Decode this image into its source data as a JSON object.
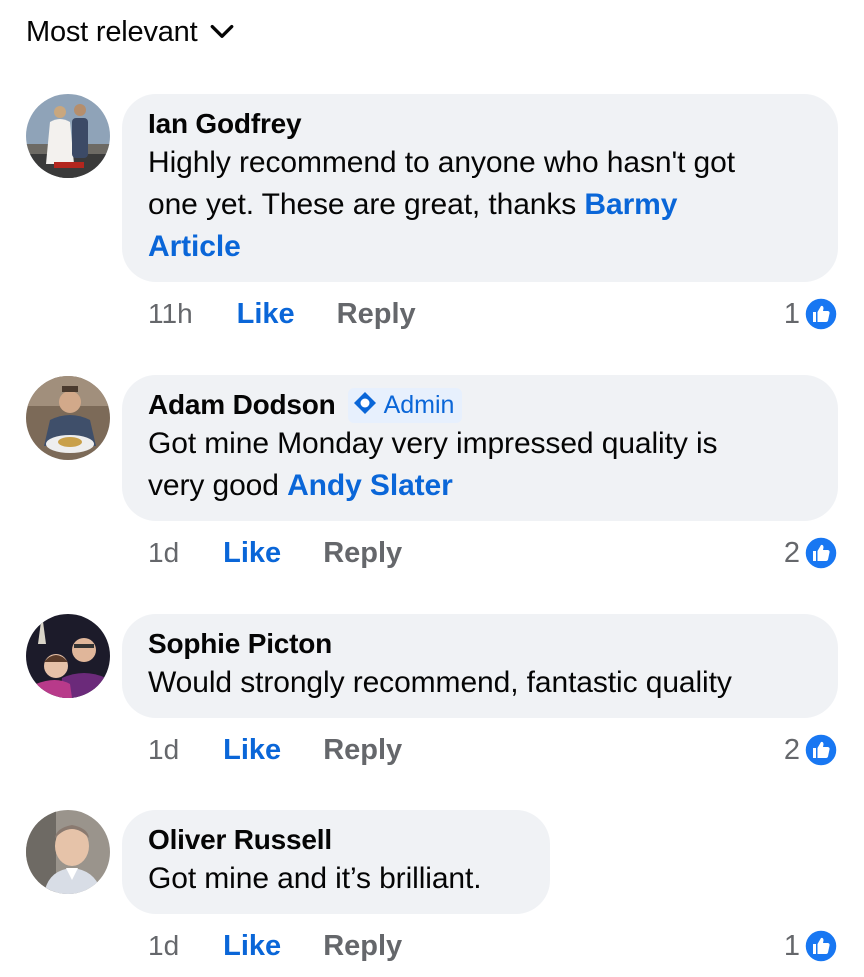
{
  "sort": {
    "label": "Most relevant",
    "icon": "chevron-down-icon"
  },
  "colors": {
    "link_blue": "#0a66d8",
    "bubble_bg": "#f0f2f5",
    "muted": "#65676b"
  },
  "comments": [
    {
      "author": "Ian Godfrey",
      "text_lines": [
        "Highly recommend to anyone who hasn't got",
        "one yet. These are great, thanks "
      ],
      "mention_1": "Barmy",
      "mention_2": "Article",
      "time": "11h",
      "like_label": "Like",
      "reply_label": "Reply",
      "reaction_count": "1"
    },
    {
      "author": "Adam Dodson",
      "badge": "Admin",
      "text_line_1": "Got mine Monday very impressed quality is",
      "text_line_2": "very good ",
      "mention": "Andy Slater",
      "time": "1d",
      "like_label": "Like",
      "reply_label": "Reply",
      "reaction_count": "2"
    },
    {
      "author": "Sophie Picton",
      "text": "Would strongly recommend, fantastic quality",
      "time": "1d",
      "like_label": "Like",
      "reply_label": "Reply",
      "reaction_count": "2"
    },
    {
      "author": "Oliver Russell",
      "text": "Got mine and it’s brilliant.",
      "time": "1d",
      "like_label": "Like",
      "reply_label": "Reply",
      "reaction_count": "1"
    }
  ]
}
